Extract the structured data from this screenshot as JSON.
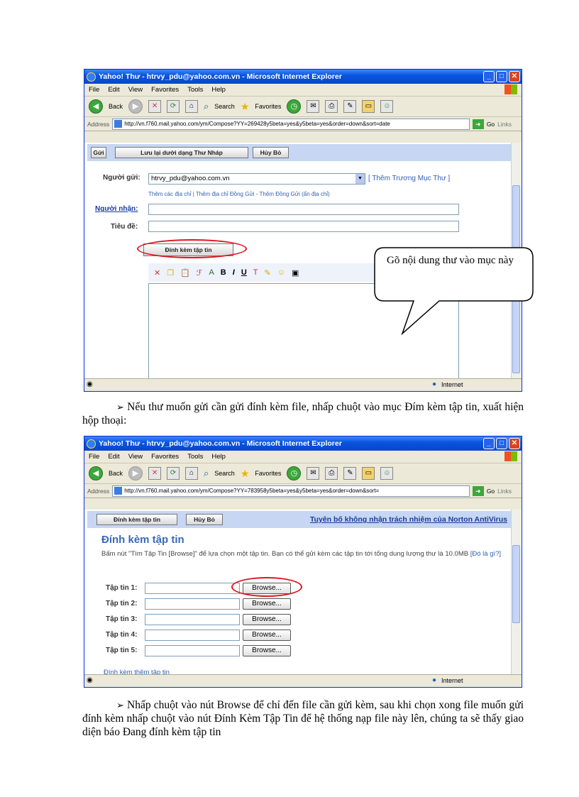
{
  "window1": {
    "title": "Yahoo! Thư - htrvy_pdu@yahoo.com.vn - Microsoft Internet Explorer",
    "menu": [
      "File",
      "Edit",
      "View",
      "Favorites",
      "Tools",
      "Help"
    ],
    "toolbar": {
      "back": "Back",
      "search": "Search",
      "favorites": "Favorites"
    },
    "address_label": "Address",
    "address": "http://vn.f760.mail.yahoo.com/ym/Compose?YY=269428y5beta=yes&y5beta=yes&order=down&sort=date",
    "go": "Go",
    "links": "Links",
    "compose_buttons": {
      "send": "Gửi",
      "save_draft": "Lưu lại dưới dạng Thư Nháp",
      "cancel": "Hủy Bỏ"
    },
    "from_label": "Người gửi:",
    "from_value": "htrvy_pdu@yahoo.com.vn",
    "add_account_link": "[ Thêm Trương Mục Thư ]",
    "address_links": "Thêm các địa chỉ | Thêm địa chỉ Đồng Gửi - Thêm Đồng Gửi (ẩn địa chỉ)",
    "to_label": "Người nhận:",
    "subject_label": "Tiêu đề:",
    "attach_button": "Đính kèm tập tin",
    "status_zone": "Internet",
    "callout": "Gõ nội dung thư vào mục này"
  },
  "paragraph1": "Nếu thư muốn gửi cần gửi đính kèm file, nhấp chuột vào mục Đím kèm tập tin, xuất hiện hộp thoại:",
  "window2": {
    "title": "Yahoo! Thư - htrvy_pdu@yahoo.com.vn - Microsoft Internet Explorer",
    "menu": [
      "File",
      "Edit",
      "View",
      "Favorites",
      "Tools",
      "Help"
    ],
    "toolbar": {
      "back": "Back",
      "search": "Search",
      "favorites": "Favorites"
    },
    "address_label": "Address",
    "address": "http://vn.f760.mail.yahoo.com/ym/Compose?YY=783958y5beta=yes&y5beta=yes&order=down&sort=",
    "go": "Go",
    "links": "Links",
    "attach_button": "Đính kèm tập tin",
    "cancel_button": "Hủy Bỏ",
    "norton_link": "Tuyên bố không nhận trách nhiệm của Norton AntiVirus",
    "heading": "Đính kèm tập tin",
    "instructions": "Bấm nút \"Tìm Tập Tin [Browse]\" để lựa chọn một tập tin. Bạn có thể gửi kèm các tập tin tới tổng dung lượng thư là 10.0MB",
    "instructions_link": "[Đó là gì?]",
    "files": [
      {
        "label": "Tập tin 1:",
        "button": "Browse..."
      },
      {
        "label": "Tập tin 2:",
        "button": "Browse..."
      },
      {
        "label": "Tập tin 3:",
        "button": "Browse..."
      },
      {
        "label": "Tập tin 4:",
        "button": "Browse..."
      },
      {
        "label": "Tập tin 5:",
        "button": "Browse..."
      }
    ],
    "more_link": "Đính kèm thêm tập tin",
    "status_zone": "Internet"
  },
  "paragraph2": "Nhấp chuột vào nút Browse để chỉ đến file cần gửi kèm, sau khi chọn xong file muốn gửi đính kèm nhấp chuột vào nút Đính Kèm Tập Tin để hệ thống nạp file này lên, chúng ta sẽ thấy giao diện báo Đang đính kèm tập tin",
  "colors": {
    "title_blue": "#0a55e0",
    "link_blue": "#2f5fb3",
    "highlight_red": "#e0141e",
    "panel_blue": "#c7d6f2"
  }
}
